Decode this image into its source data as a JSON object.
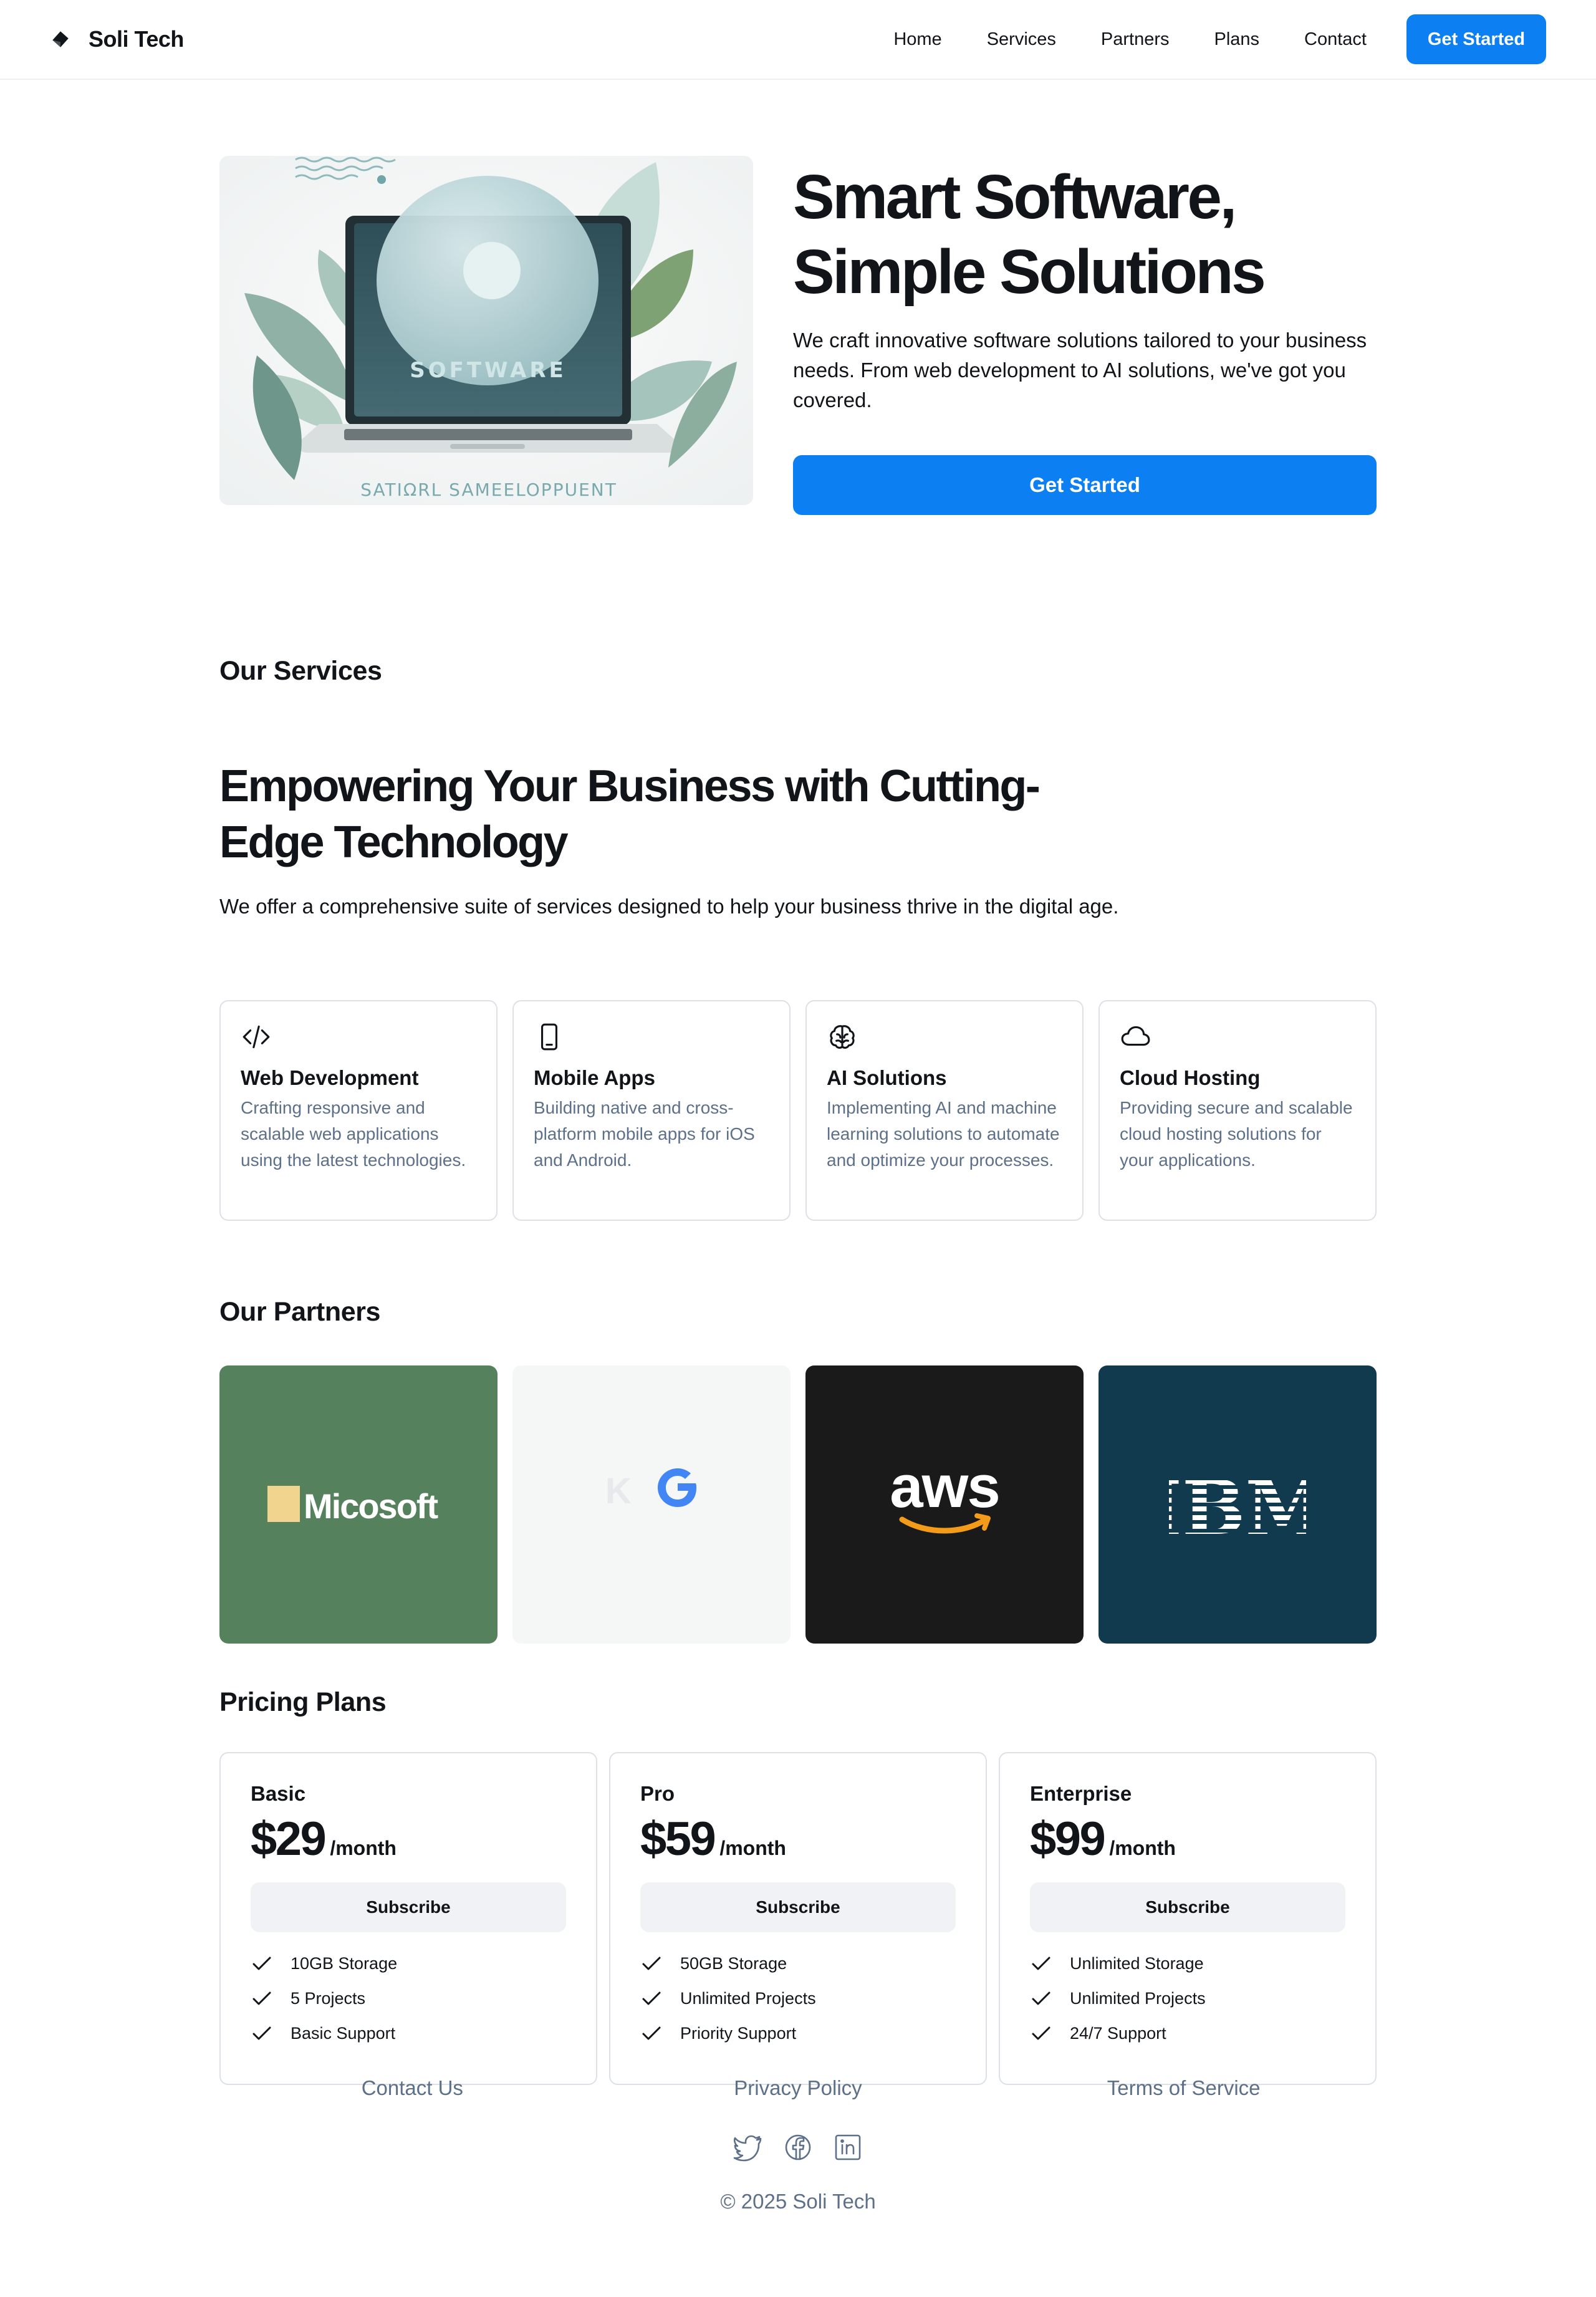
{
  "header": {
    "brand": "Soli Tech",
    "nav": [
      "Home",
      "Services",
      "Partners",
      "Plans",
      "Contact"
    ],
    "cta": "Get Started"
  },
  "hero": {
    "title_line1": "Smart Software,",
    "title_line2": "Simple Solutions",
    "subtitle": "We craft innovative software solutions tailored to your business needs. From web development to AI solutions, we've got you covered.",
    "cta": "Get Started",
    "image": {
      "screen_text": "SOFTWARE",
      "caption": "SATIΩRL SAMEELOPPUENT"
    }
  },
  "services": {
    "label": "Our Services",
    "title": "Empowering Your Business with Cutting-Edge Technology",
    "subtitle": "We offer a comprehensive suite of services designed to help your business thrive in the digital age.",
    "items": [
      {
        "icon": "code-icon",
        "title": "Web Development",
        "desc": "Crafting responsive and scalable web applications using the latest technologies."
      },
      {
        "icon": "mobile-phone-icon",
        "title": "Mobile Apps",
        "desc": "Building native and cross-platform mobile apps for iOS and Android."
      },
      {
        "icon": "brain-icon",
        "title": "AI Solutions",
        "desc": "Implementing AI and machine learning solutions to automate and optimize your processes."
      },
      {
        "icon": "cloud-icon",
        "title": "Cloud Hosting",
        "desc": "Providing secure and scalable cloud hosting solutions for your applications."
      }
    ]
  },
  "partners": {
    "label": "Our Partners",
    "items": [
      {
        "name": "Micosoft",
        "bg": "#55825c"
      },
      {
        "name": "K G",
        "bg": "#f5f6f6"
      },
      {
        "name": "aws",
        "bg": "#1a1a1a"
      },
      {
        "name": "IBM",
        "bg": "#123a4e"
      }
    ]
  },
  "pricing": {
    "label": "Pricing Plans",
    "plans": [
      {
        "name": "Basic",
        "price": "$29",
        "period": "/month",
        "button": "Subscribe",
        "features": [
          "10GB Storage",
          "5 Projects",
          "Basic Support"
        ]
      },
      {
        "name": "Pro",
        "price": "$59",
        "period": "/month",
        "button": "Subscribe",
        "features": [
          "50GB Storage",
          "Unlimited Projects",
          "Priority Support"
        ]
      },
      {
        "name": "Enterprise",
        "price": "$99",
        "period": "/month",
        "button": "Subscribe",
        "features": [
          "Unlimited Storage",
          "Unlimited Projects",
          "24/7 Support"
        ]
      }
    ]
  },
  "footer": {
    "links": [
      "Contact Us",
      "Privacy Policy",
      "Terms of Service"
    ],
    "socials": [
      "twitter-icon",
      "facebook-icon",
      "linkedin-icon"
    ],
    "copyright": "© 2025 Soli Tech"
  },
  "colors": {
    "accent": "#0c7ff2",
    "muted_text": "#5d7089",
    "border": "#dde1e6",
    "button_gray": "#f0f2f5"
  }
}
